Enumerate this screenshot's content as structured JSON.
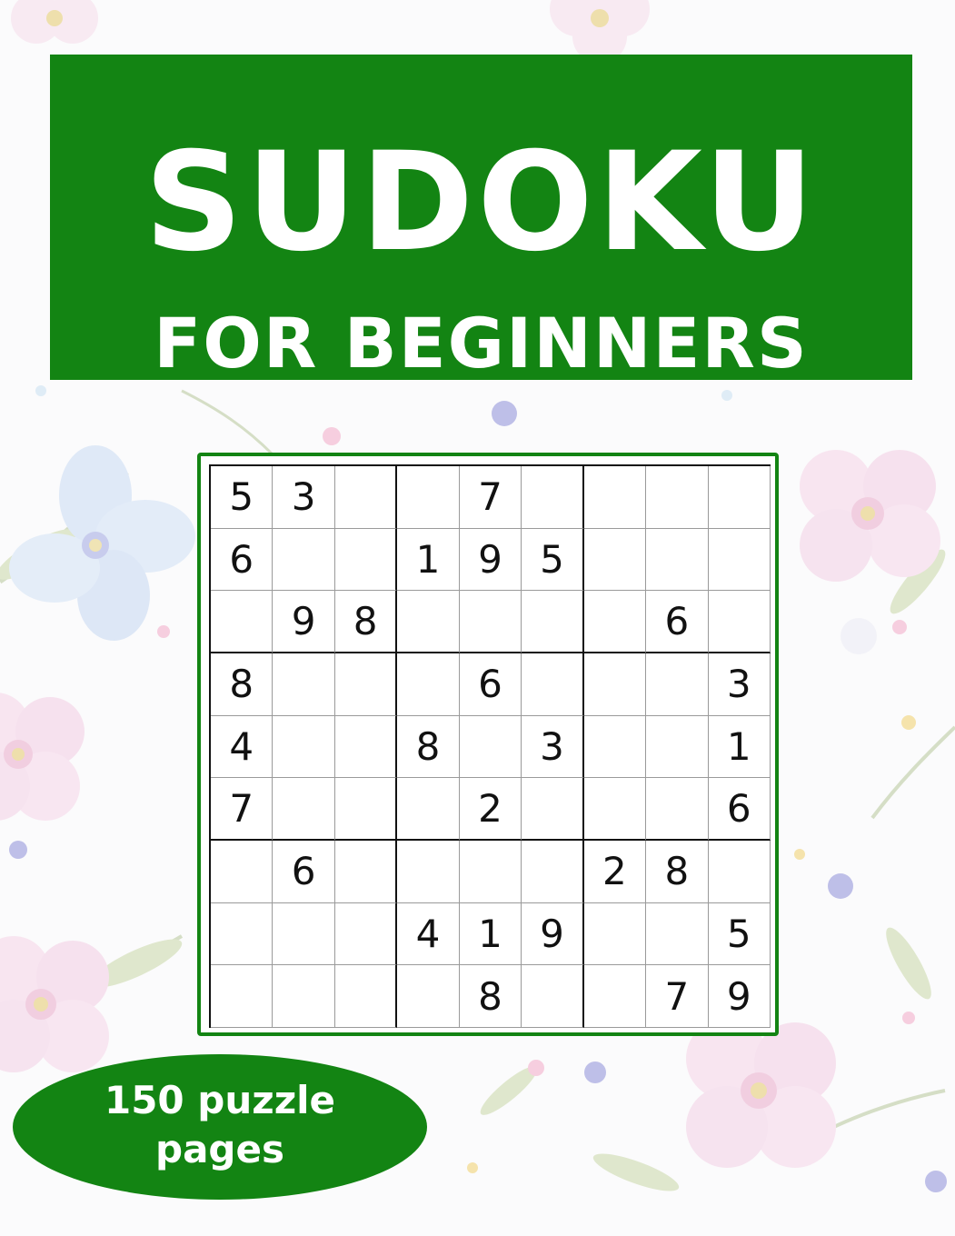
{
  "cover": {
    "title": "SUDOKU",
    "subtitle": "FOR BEGINNERS",
    "badge_line1": "150 puzzle",
    "badge_line2": "pages",
    "accent_color": "#138413"
  },
  "puzzle": {
    "rows": [
      [
        "5",
        "3",
        "",
        "",
        "7",
        "",
        "",
        "",
        ""
      ],
      [
        "6",
        "",
        "",
        "1",
        "9",
        "5",
        "",
        "",
        ""
      ],
      [
        "",
        "9",
        "8",
        "",
        "",
        "",
        "",
        "6",
        ""
      ],
      [
        "8",
        "",
        "",
        "",
        "6",
        "",
        "",
        "",
        "3"
      ],
      [
        "4",
        "",
        "",
        "8",
        "",
        "3",
        "",
        "",
        "1"
      ],
      [
        "7",
        "",
        "",
        "",
        "2",
        "",
        "",
        "",
        "6"
      ],
      [
        "",
        "6",
        "",
        "",
        "",
        "",
        "2",
        "8",
        ""
      ],
      [
        "",
        "",
        "",
        "4",
        "1",
        "9",
        "",
        "",
        "5"
      ],
      [
        "",
        "",
        "",
        "",
        "8",
        "",
        "",
        "7",
        "9"
      ]
    ]
  }
}
